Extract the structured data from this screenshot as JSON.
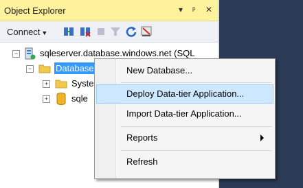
{
  "window": {
    "title": "Object Explorer",
    "controls": [
      "▾",
      "ᵖ",
      "✕"
    ]
  },
  "toolbar": {
    "connect_label": "Connect",
    "icons": [
      "connect-object-explorer-icon",
      "disconnect-icon",
      "stop-icon",
      "filter-icon",
      "refresh-icon",
      "azure-icon"
    ]
  },
  "tree": {
    "server": "sqleserver.database.windows.net (SQL",
    "databases": "Databases",
    "system": "Syste",
    "userdb": "sqle"
  },
  "context_menu": {
    "items": [
      {
        "label": "New Database..."
      },
      {
        "label": "Deploy Data-tier Application..."
      },
      {
        "label": "Import Data-tier Application..."
      },
      {
        "label": "Reports"
      },
      {
        "label": "Refresh"
      }
    ]
  },
  "colors": {
    "title_bg": "#fff29d",
    "selection": "#3399ff",
    "menu_hover": "#cde8ff",
    "background": "#2b3a55"
  }
}
